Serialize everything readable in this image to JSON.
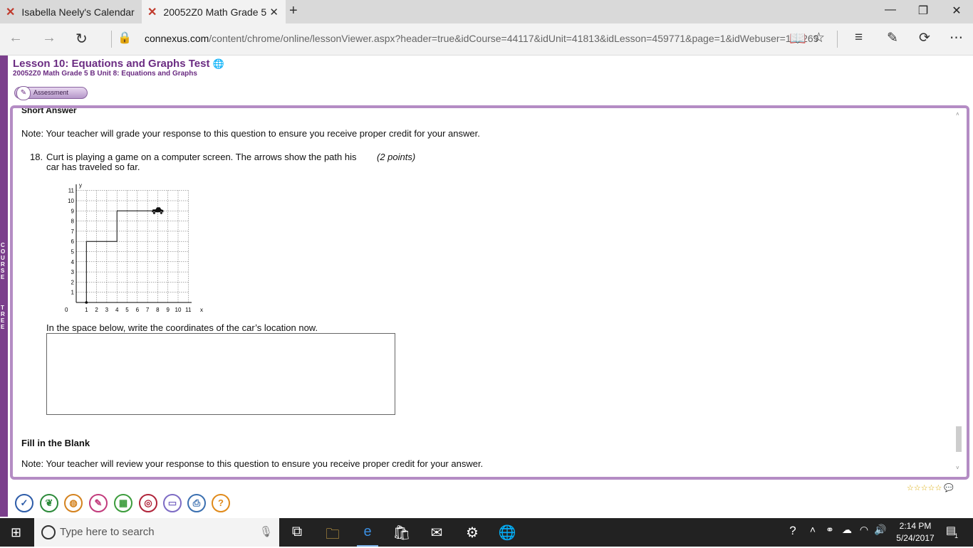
{
  "browser": {
    "tabs": [
      {
        "label": "Isabella Neely's Calendar",
        "icon": "connexus-x-icon"
      },
      {
        "label": "20052Z0 Math Grade 5",
        "icon": "connexus-x-icon",
        "active": true
      }
    ],
    "new_tab": "+",
    "url_domain": "connexus.com",
    "url_path": "/content/chrome/online/lessonViewer.aspx?header=true&idCourse=44117&idUnit=41813&idLesson=459771&page=1&idWebuser=155269"
  },
  "lesson": {
    "title": "Lesson 10: Equations and Graphs Test",
    "subtitle": "20052Z0 Math Grade 5 B  Unit 8: Equations and Graphs",
    "assessment_label": "Assessment"
  },
  "sidebar_letters": [
    "C",
    "O",
    "U",
    "R",
    "S",
    "E",
    "T",
    "R",
    "E",
    "E"
  ],
  "content": {
    "section_cut": "Short Answer",
    "note1": "Note: Your teacher will grade your response to this question to ensure you receive proper credit for your answer.",
    "question_number": "18.",
    "question_line1": "Curt is playing a game on a computer screen. The arrows show the path his",
    "question_line2": "car has traveled so far.",
    "points": "(2 points)",
    "prompt": "In the space below, write the coordinates of the car’s location now.",
    "section2": "Fill in the Blank",
    "note2": "Note: Your teacher will review your response to this question to ensure you receive proper credit for your answer."
  },
  "graph": {
    "x_ticks": [
      "1",
      "2",
      "3",
      "4",
      "5",
      "6",
      "7",
      "8",
      "9",
      "10",
      "11"
    ],
    "y_ticks": [
      "1",
      "2",
      "3",
      "4",
      "5",
      "6",
      "7",
      "8",
      "9",
      "10",
      "11"
    ],
    "origin_label": "0",
    "x_label": "x",
    "y_label": "y",
    "path": [
      [
        1,
        0
      ],
      [
        1,
        6
      ],
      [
        4,
        6
      ],
      [
        4,
        9
      ],
      [
        8,
        9
      ]
    ]
  },
  "bottom_toolbar": [
    "check-icon",
    "leaf-icon",
    "globe-icon",
    "pencil-icon",
    "calculator-icon",
    "target-icon",
    "book-icon",
    "print-icon",
    "help-icon"
  ],
  "rating": "☆☆☆☆☆",
  "taskbar": {
    "search_placeholder": "Type here to search",
    "time": "2:14 PM",
    "date": "5/24/2017",
    "notification_count": "1"
  }
}
